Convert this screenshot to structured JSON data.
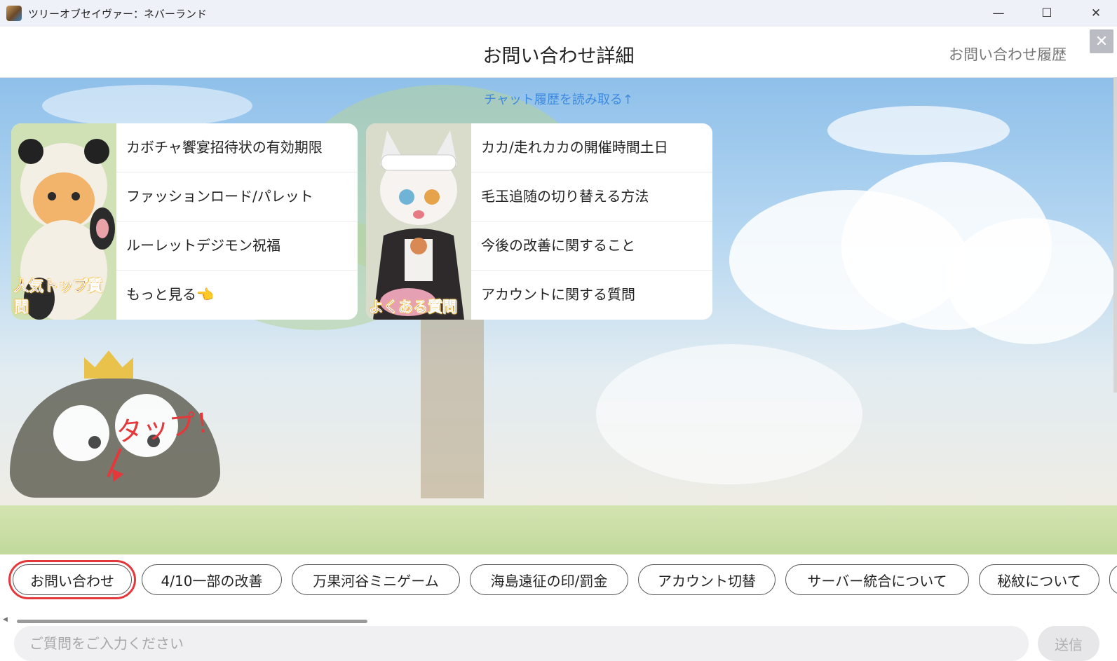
{
  "window": {
    "title": "ツリーオブセイヴァー：ネバーランド",
    "minimize": "—",
    "maximize": "☐",
    "close": "✕"
  },
  "header": {
    "title": "お問い合わせ詳細",
    "history_link": "お問い合わせ履歴",
    "close": "✕"
  },
  "chat": {
    "history_link": "チャット履歴を読み取る↑"
  },
  "annotation": {
    "text": "タップ！"
  },
  "cards": [
    {
      "label": "人気トップ質問",
      "items": [
        "カボチャ饗宴招待状の有効期限",
        "ファッションロード/パレット",
        "ルーレットデジモン祝福",
        "もっと見る"
      ],
      "more_icon": "👈"
    },
    {
      "label": "よくある質問",
      "items": [
        "カカ/走れカカの開催時間土日",
        "毛玉追随の切り替える方法",
        "今後の改善に関すること",
        "アカウントに関する質問"
      ]
    }
  ],
  "chips": [
    "お問い合わせ",
    "4/10一部の改善",
    "万果河谷ミニゲーム",
    "海島遠征の印/罰金",
    "アカウント切替",
    "サーバー統合について",
    "秘紋について"
  ],
  "input": {
    "placeholder": "ご質問をご入力ください",
    "value": ""
  },
  "send_label": "送信",
  "colors": {
    "link_blue": "#3f8be0",
    "annotation_red": "#e5383b"
  }
}
